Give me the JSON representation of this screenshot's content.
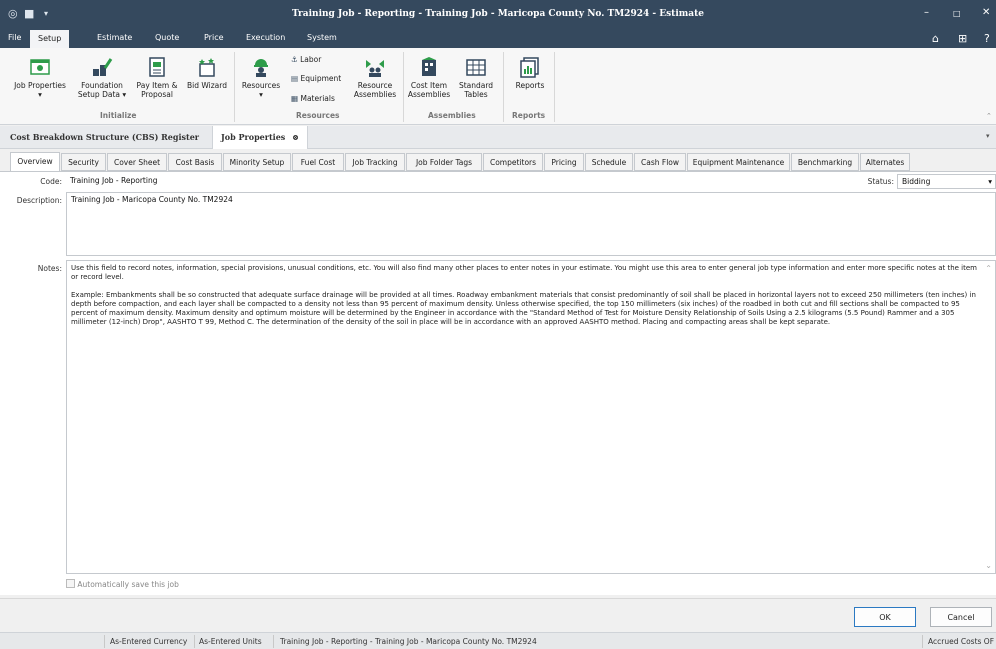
{
  "window": {
    "title": "Training Job - Reporting - Training Job - Maricopa County No. TM2924 - Estimate",
    "title_color": "#35495e"
  },
  "menu": {
    "items": [
      "File",
      "Setup",
      "Estimate",
      "Quote",
      "Price",
      "Execution",
      "System"
    ],
    "active": "Setup"
  },
  "ribbon": {
    "buttons": {
      "job_properties": "Job Properties",
      "foundation_line1": "Foundation",
      "foundation_line2": "Setup Data",
      "payitem_line1": "Pay Item &",
      "payitem_line2": "Proposal",
      "bid_wizard": "Bid Wizard",
      "resources": "Resources",
      "labor": "Labor",
      "equipment": "Equipment",
      "materials": "Materials",
      "resource_assemblies_line1": "Resource",
      "resource_assemblies_line2": "Assemblies",
      "cost_item_line1": "Cost Item",
      "cost_item_line2": "Assemblies",
      "standard_tables_line1": "Standard",
      "standard_tables_line2": "Tables",
      "reports": "Reports"
    },
    "groups": {
      "initialize": "Initialize",
      "resources": "Resources",
      "assemblies": "Assemblies",
      "reports": "Reports"
    }
  },
  "doc_tabs": {
    "cbs": "Cost Breakdown Structure (CBS) Register",
    "job_properties": "Job Properties"
  },
  "prop_tabs": [
    "Overview",
    "Security",
    "Cover Sheet",
    "Cost Basis",
    "Minority Setup",
    "Fuel Cost",
    "Job Tracking",
    "Job Folder Tags",
    "Competitors",
    "Pricing",
    "Schedule",
    "Cash Flow",
    "Equipment Maintenance",
    "Benchmarking",
    "Alternates"
  ],
  "form": {
    "code_label": "Code:",
    "code_value": "Training Job - Reporting",
    "status_label": "Status:",
    "status_value": "Bidding",
    "description_label": "Description:",
    "description_value": "Training Job - Maricopa County No. TM2924",
    "notes_label": "Notes:",
    "notes_p1": "Use this field to record notes, information, special provisions, unusual conditions, etc. You will also find many other places to enter notes in your estimate. You might use this area to enter general job type information and enter more specific notes at the item or record level.",
    "notes_p2": "Example:  Embankments shall be so constructed that adequate surface drainage will be provided at all times. Roadway embankment materials that consist predominantly of soil shall be placed in horizontal layers not to exceed 250 millimeters (ten inches) in depth before compaction, and each layer shall be compacted to a density not less than 95 percent of maximum density. Unless otherwise specified, the top 150 millimeters (six inches) of the roadbed in both cut and fill sections shall be compacted to 95 percent of maximum density. Maximum density and optimum moisture will be determined by the Engineer in accordance with the \"Standard Method of Test for Moisture Density Relationship of Soils Using a 2.5 kilograms (5.5 Pound) Rammer and a 305 millimeter (12-inch) Drop\", AASHTO T 99, Method C. The determination of the density of the soil in place will be in accordance with an approved AASHTO method. Placing and compacting areas shall be kept separate.",
    "autosave_label": "Automatically save this job"
  },
  "buttons": {
    "ok": "OK",
    "cancel": "Cancel"
  },
  "status_bar": {
    "currency": "As-Entered Currency",
    "units": "As-Entered Units",
    "job": "Training Job - Reporting - Training Job - Maricopa County No. TM2924",
    "accrued": "Accrued Costs OF"
  },
  "colors": {
    "accent": "#2b79c2",
    "ribbon_green": "#2e9c4a",
    "ribbon_navy": "#34495e"
  }
}
